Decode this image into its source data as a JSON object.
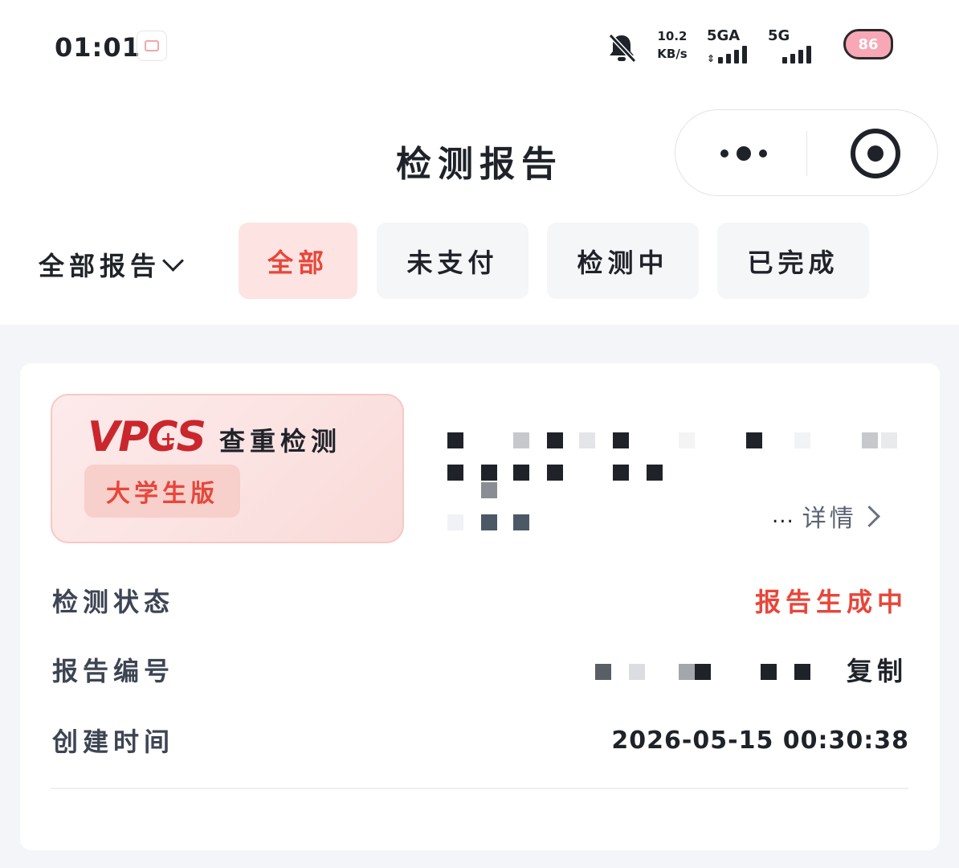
{
  "status_bar": {
    "time": "01:01",
    "speed_value": "10.2",
    "speed_unit": "KB/s",
    "network_1": "5GA",
    "network_2": "5G",
    "battery": "86"
  },
  "header": {
    "title": "检测报告"
  },
  "filters": {
    "dropdown_label": "全部报告",
    "tabs": [
      {
        "label": "全部",
        "active": true
      },
      {
        "label": "未支付",
        "active": false
      },
      {
        "label": "检测中",
        "active": false
      },
      {
        "label": "已完成",
        "active": false
      }
    ]
  },
  "report_card": {
    "logo_text_v": "VP",
    "logo_text_c": "C",
    "logo_text_s": "S",
    "product_name": "查重检测",
    "edition": "大学生版",
    "detail_prefix": "...",
    "detail_link": "详情",
    "rows": {
      "status_label": "检测状态",
      "status_value": "报告生成中",
      "number_label": "报告编号",
      "copy_label": "复制",
      "created_label": "创建时间",
      "created_value": "2026-05-15 00:30:38"
    }
  },
  "colors": {
    "accent_red": "#e8463a",
    "active_tab_bg": "#fde4e2",
    "page_bg": "#f4f5f8"
  },
  "icons": {
    "mute": "bell-off-icon",
    "more": "more-dots-icon",
    "close": "target-close-icon",
    "dropdown": "chevron-down-icon",
    "detail": "chevron-right-icon"
  }
}
